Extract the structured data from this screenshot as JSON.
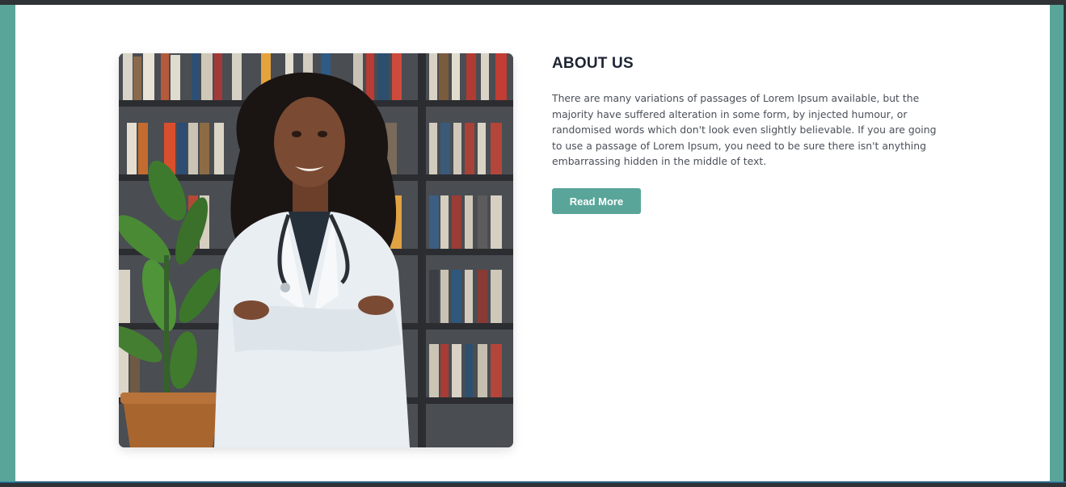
{
  "about": {
    "title": "ABOUT US",
    "description": "There are many variations of passages of Lorem Ipsum available, but the majority have suffered alteration in some form, by injected humour, or randomised words which don't look even slightly believable. If you are going to use a passage of Lorem Ipsum, you need to be sure there isn't anything embarrassing hidden in the middle of text.",
    "button_label": "Read More"
  },
  "colors": {
    "accent": "#5aa59a",
    "title": "#1d2433",
    "text": "#4a4f58",
    "frame": "#2f3336"
  },
  "image": {
    "subject": "doctor-in-library-photo"
  }
}
